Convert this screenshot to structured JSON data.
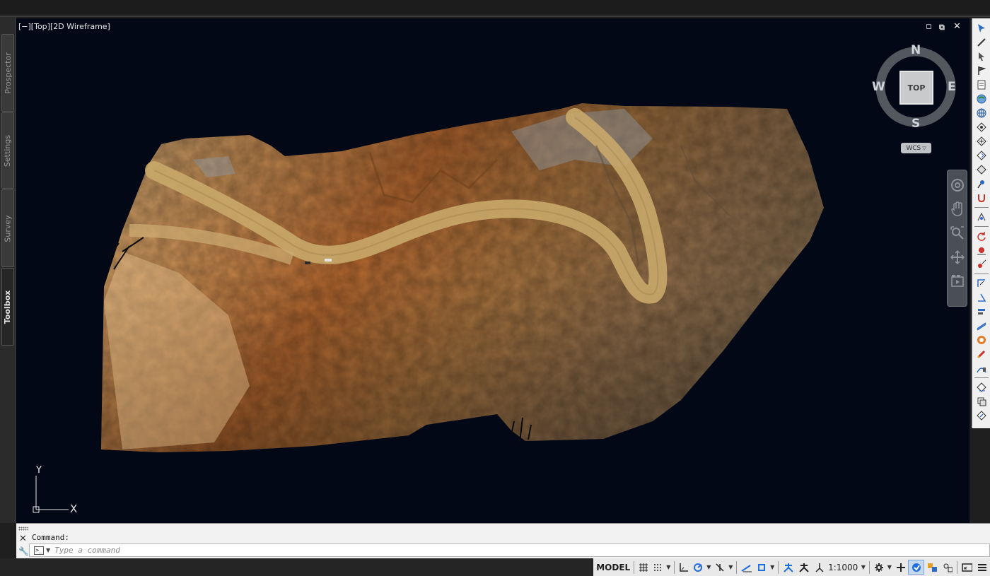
{
  "left_tabs": [
    {
      "label": "Prospector"
    },
    {
      "label": "Settings"
    },
    {
      "label": "Survey"
    },
    {
      "label": "Toolbox"
    }
  ],
  "viewport": {
    "label": "[−][Top][2D Wireframe]",
    "restore_label": "▫",
    "maximize_label": "⧉",
    "close_label": "✕"
  },
  "viewcube": {
    "north": "N",
    "south": "S",
    "east": "E",
    "west": "W",
    "face": "TOP",
    "wcs": "WCS"
  },
  "ucs": {
    "x": "X",
    "y": "Y"
  },
  "command": {
    "history_label": "Command:",
    "prompt_icon": ">_",
    "placeholder": "Type a command"
  },
  "status_bar": {
    "model_label": "MODEL",
    "scale_label": "1:1000"
  },
  "colors": {
    "viewport_bg": "#030816",
    "accent_blue": "#1f6fe0",
    "terrain_main": "#b5773b"
  }
}
